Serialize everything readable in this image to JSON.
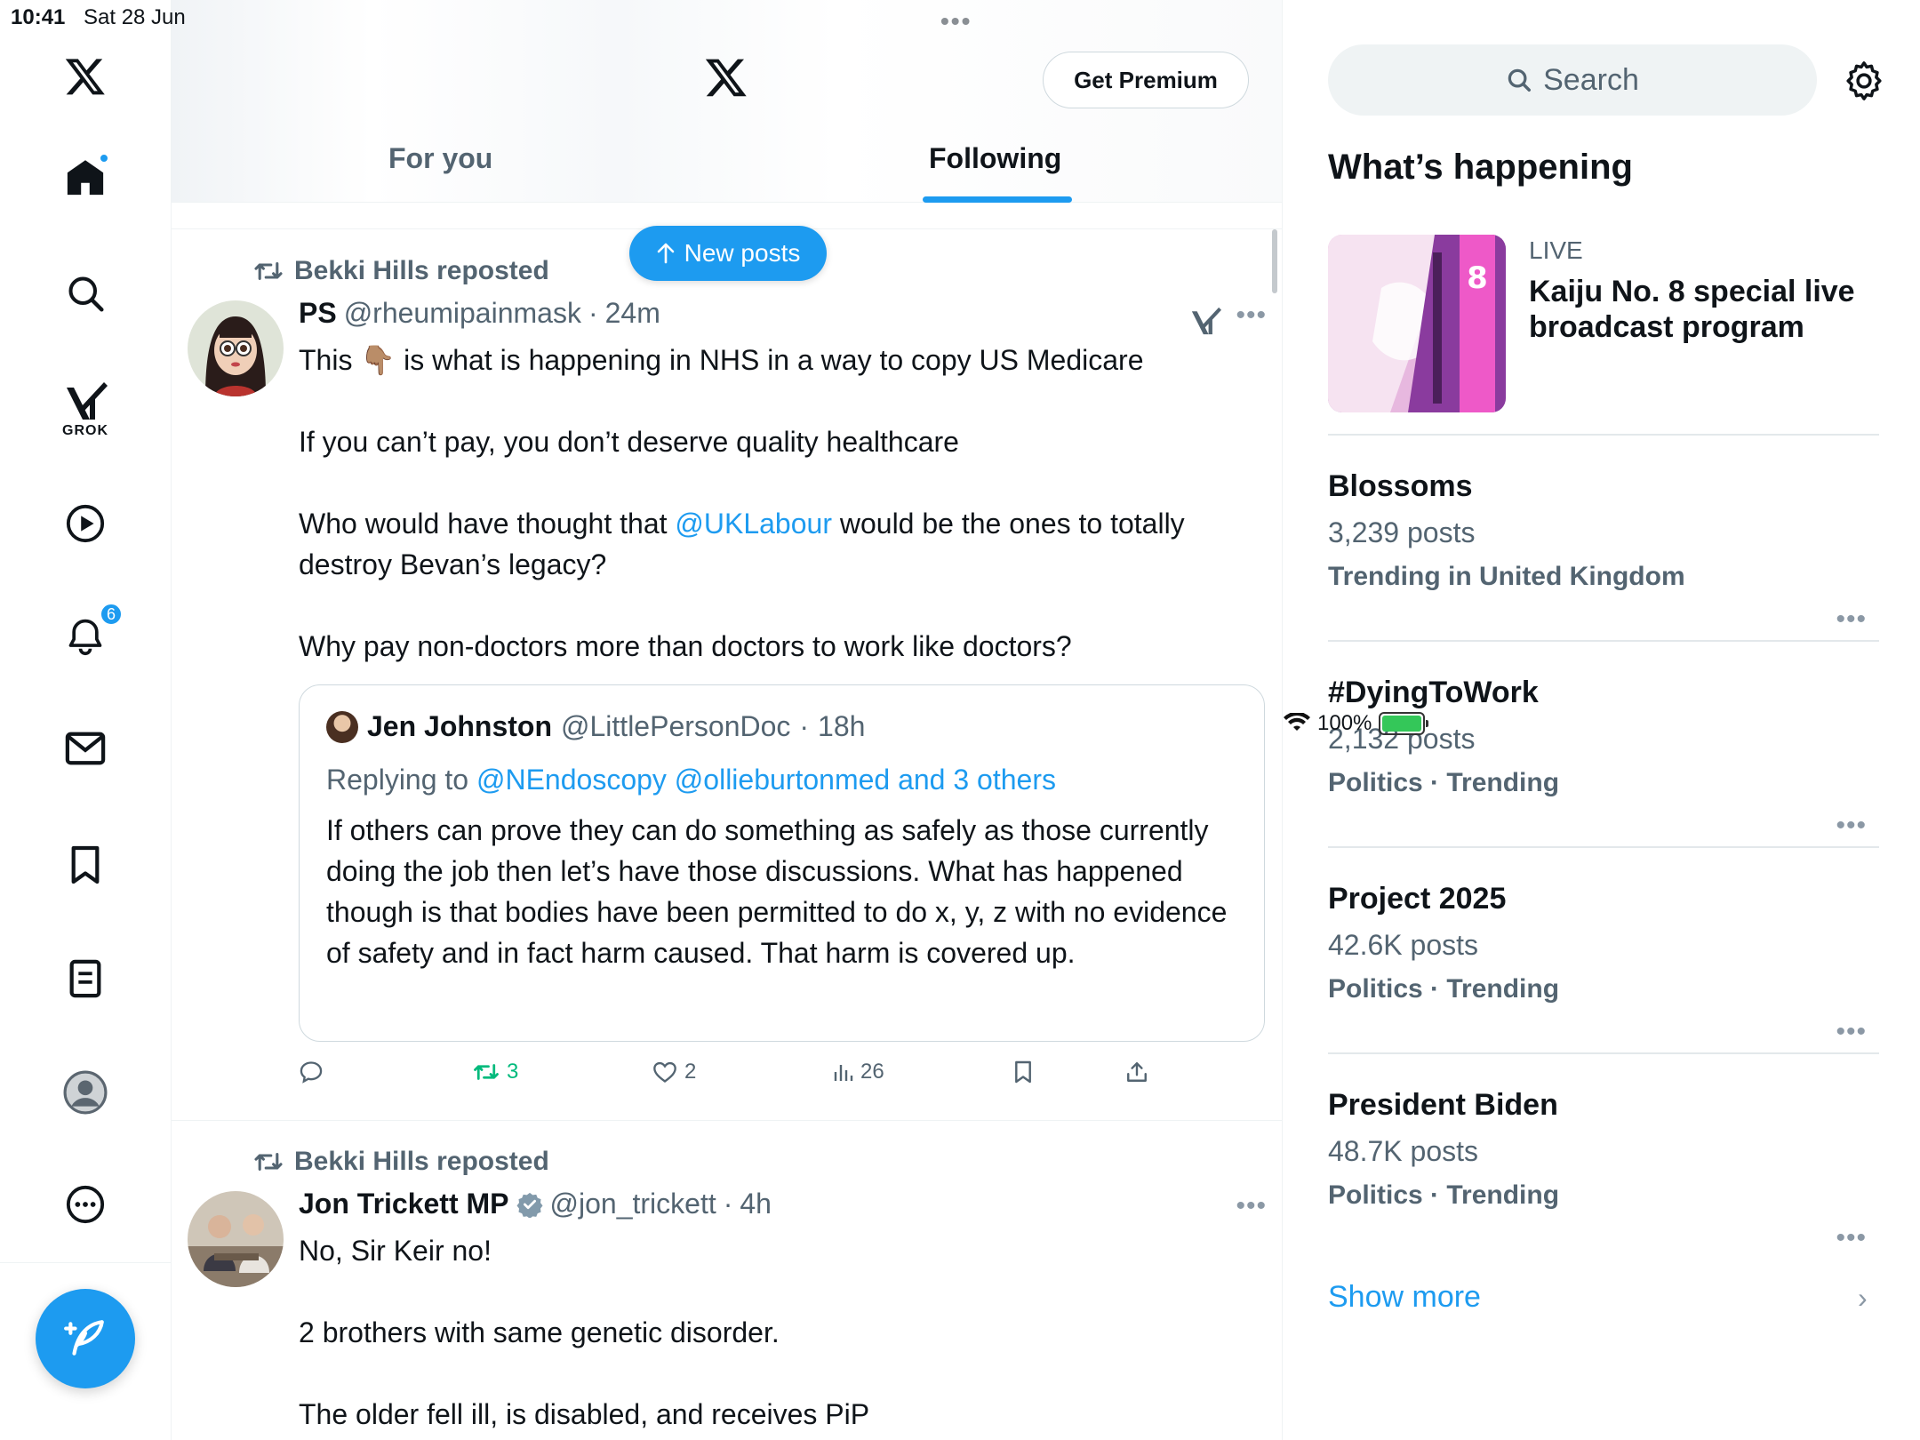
{
  "status_bar": {
    "time": "10:41",
    "date": "Sat 28 Jun",
    "battery": "100%"
  },
  "rail": {
    "grok_label": "GROK",
    "notifications_count": "6"
  },
  "header": {
    "premium_label": "Get Premium",
    "tabs": [
      {
        "label": "For you"
      },
      {
        "label": "Following"
      }
    ],
    "new_posts_label": "New posts"
  },
  "posts": [
    {
      "repost_by": "Bekki Hills reposted",
      "name": "PS",
      "handle": "@rheumipainmask",
      "time": "24m",
      "text_line1_a": "This",
      "text_emoji": "👇🏽",
      "text_line1_b": "is what is happening in NHS in a way to copy US Medicare",
      "text_line2": "If you can’t pay, you don’t deserve quality healthcare",
      "text_line3_a": "Who would have thought that",
      "text_mention": "@UKLabour",
      "text_line3_b": "would be the ones to totally destroy Bevan’s legacy?",
      "text_line4": "Why pay non-doctors more than doctors to work like doctors?",
      "quote": {
        "name": "Jen Johnston",
        "handle": "@LittlePersonDoc",
        "time": "18h",
        "replying_to": "Replying to",
        "replying_mentions": "@NEndoscopy @ollieburtonmed and 3 others",
        "text": "If others can prove they can do something as safely as those currently doing the job then let’s have those discussions. What has happened though is that bodies have been permitted to do x, y, z with no evidence of safety and in fact harm caused. That harm is covered up."
      },
      "actions": {
        "reposts": "3",
        "likes": "2",
        "views": "26"
      }
    },
    {
      "repost_by": "Bekki Hills reposted",
      "name": "Jon Trickett MP",
      "handle": "@jon_trickett",
      "time": "4h",
      "text_line1": "No, Sir Keir no!",
      "text_line2": "2 brothers with same genetic disorder.",
      "text_line3": "The older fell ill, is disabled, and  receives PiP"
    }
  ],
  "sidebar": {
    "search_placeholder": "Search",
    "title": "What’s happening",
    "live": {
      "label": "LIVE",
      "title": "Kaiju No. 8 special live broadcast program"
    },
    "trends": [
      {
        "name": "Blossoms",
        "count": "3,239 posts",
        "context": "Trending in United Kingdom"
      },
      {
        "name": "#DyingToWork",
        "count": "2,132 posts",
        "context": "Politics · Trending"
      },
      {
        "name": "Project 2025",
        "count": "42.6K posts",
        "context": "Politics · Trending"
      },
      {
        "name": "President Biden",
        "count": "48.7K posts",
        "context": "Politics · Trending"
      }
    ],
    "show_more": "Show more"
  }
}
